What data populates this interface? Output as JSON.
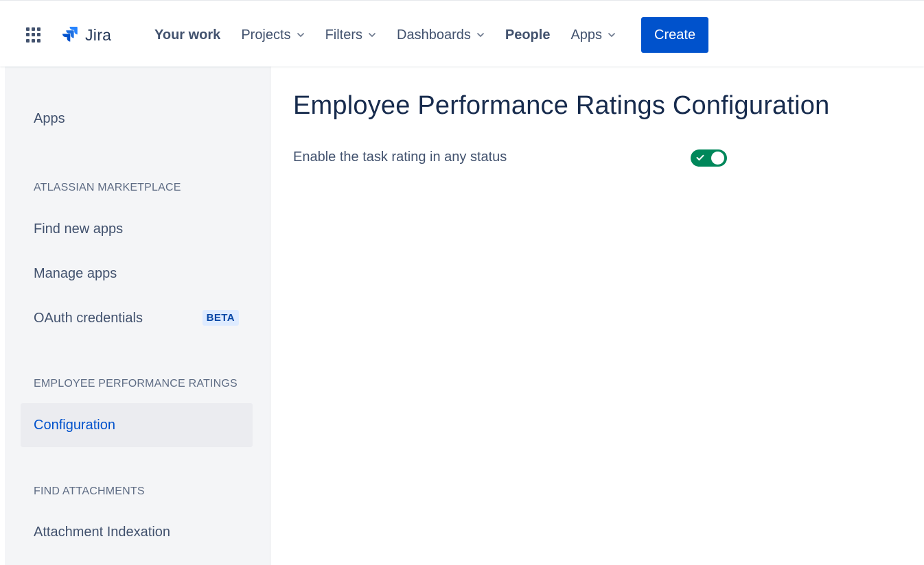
{
  "topbar": {
    "logo_text": "Jira",
    "nav": [
      {
        "label": "Your work",
        "dropdown": false,
        "bold": true
      },
      {
        "label": "Projects",
        "dropdown": true,
        "bold": false
      },
      {
        "label": "Filters",
        "dropdown": true,
        "bold": false
      },
      {
        "label": "Dashboards",
        "dropdown": true,
        "bold": false
      },
      {
        "label": "People",
        "dropdown": false,
        "bold": true
      },
      {
        "label": "Apps",
        "dropdown": true,
        "bold": false
      }
    ],
    "create_label": "Create",
    "icons": {
      "app_switcher": "grid-icon",
      "logo": "jira-logo-icon",
      "dropdown": "chevron-down-icon"
    }
  },
  "sidebar": {
    "title": "Apps",
    "sections": [
      {
        "heading": "ATLASSIAN MARKETPLACE",
        "items": [
          {
            "label": "Find new apps"
          },
          {
            "label": "Manage apps"
          },
          {
            "label": "OAuth credentials",
            "badge": "BETA"
          }
        ]
      },
      {
        "heading": "EMPLOYEE PERFORMANCE RATINGS",
        "items": [
          {
            "label": "Configuration",
            "active": true
          }
        ]
      },
      {
        "heading": "FIND ATTACHMENTS",
        "items": [
          {
            "label": "Attachment Indexation"
          }
        ]
      }
    ]
  },
  "main": {
    "title": "Employee Performance Ratings Configuration",
    "setting_label": "Enable the task rating in any status",
    "toggle_on": true
  },
  "colors": {
    "brand_blue": "#0052cc",
    "toggle_green": "#00875a",
    "sidebar_bg": "#f4f5f7",
    "text_dark": "#172b4d",
    "text_muted": "#42526e"
  }
}
